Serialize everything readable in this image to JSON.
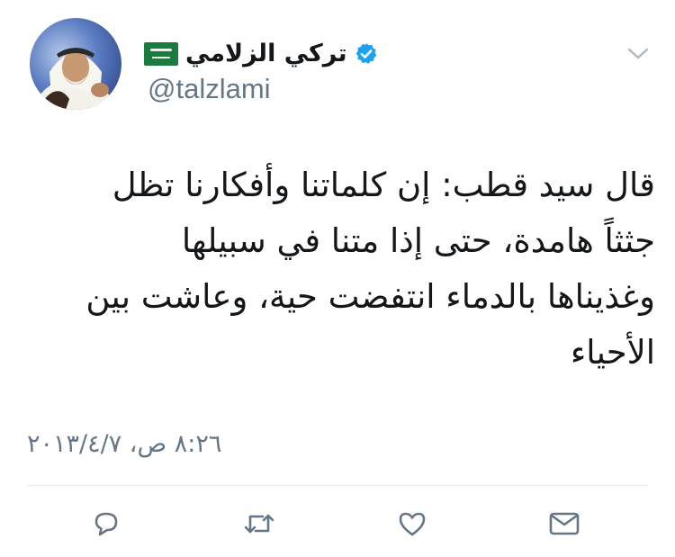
{
  "user": {
    "display_name": "تركي الزلامي",
    "handle": "@talzlami",
    "verified": true,
    "flag": "saudi-flag"
  },
  "tweet": {
    "text_lines": [
      "قال سيد قطب: إن كلماتنا وأفكارنا تظل",
      "جثثاً هامدة، حتى إذا متنا في سبيلها",
      "وغذيناها بالدماء انتفضت حية، وعاشت بين",
      "الأحياء"
    ],
    "timestamp": "٨:٢٦ ص، ٢٠١٣/٤/٧"
  },
  "actions": {
    "icons": [
      "reply-icon",
      "retweet-icon",
      "like-icon",
      "direct-message-icon"
    ]
  },
  "colors": {
    "text": "#14171a",
    "secondary": "#657786",
    "verified": "#1da1f2",
    "divider": "#e6ecf0",
    "flag": "#1b7a3e"
  }
}
